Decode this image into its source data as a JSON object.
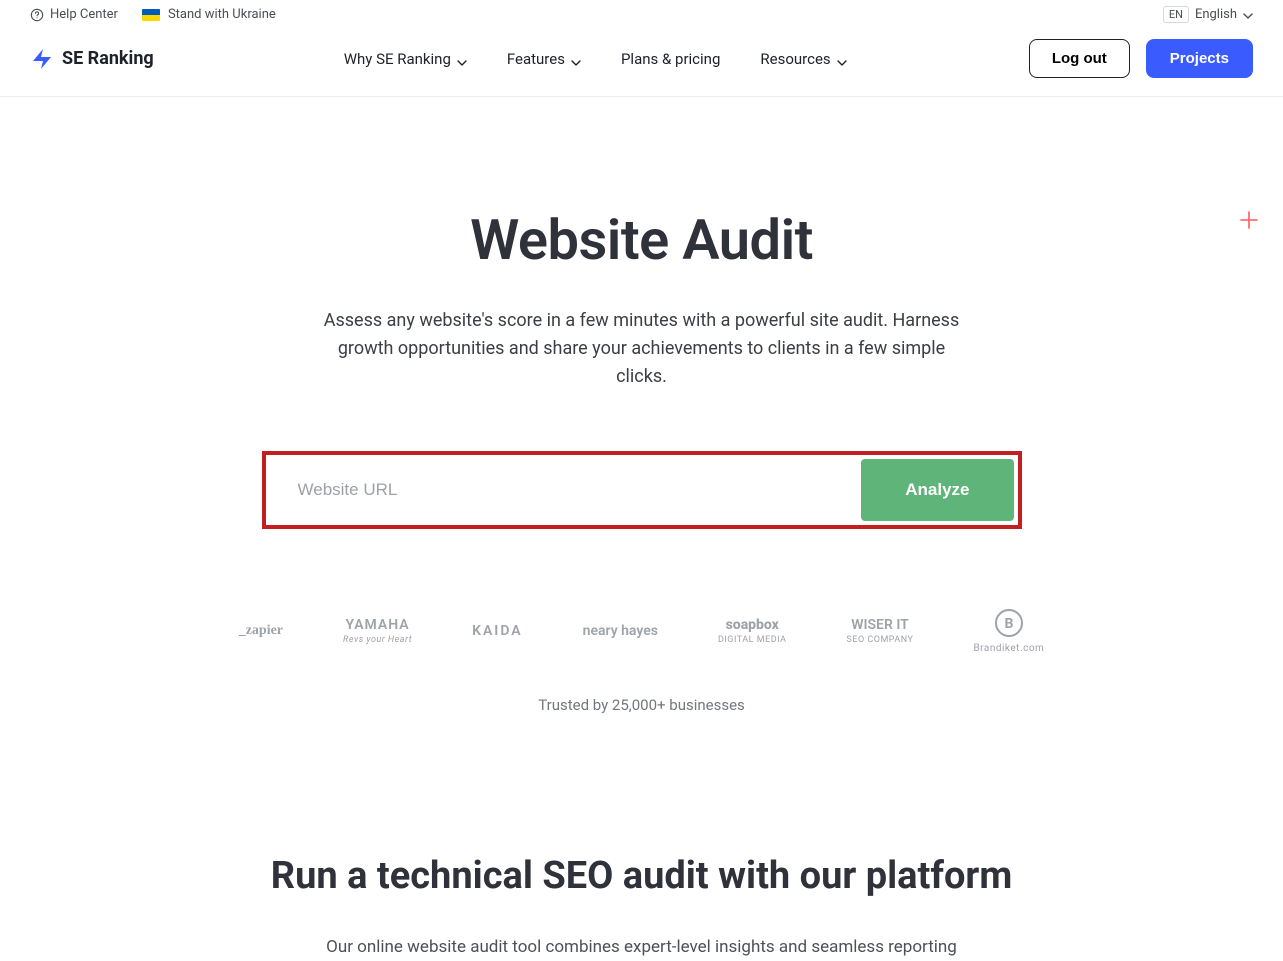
{
  "topbar": {
    "help_label": "Help Center",
    "ukraine_label": "Stand with Ukraine",
    "lang_code": "EN",
    "lang_name": "English"
  },
  "brand": {
    "name": "SE Ranking"
  },
  "nav": {
    "items": [
      {
        "label": "Why SE Ranking",
        "dropdown": true
      },
      {
        "label": "Features",
        "dropdown": true
      },
      {
        "label": "Plans & pricing",
        "dropdown": false
      },
      {
        "label": "Resources",
        "dropdown": true
      }
    ]
  },
  "actions": {
    "logout_label": "Log out",
    "projects_label": "Projects"
  },
  "hero": {
    "title": "Website Audit",
    "subtitle": "Assess any website's score in a few minutes with a powerful site audit. Harness growth opportunities and share your achievements to clients in a few simple clicks."
  },
  "url_form": {
    "placeholder": "Website URL",
    "value": "",
    "analyze_label": "Analyze"
  },
  "logos": {
    "items": [
      {
        "name": "_zapier",
        "sub": ""
      },
      {
        "name": "YAMAHA",
        "sub": "Revs your Heart"
      },
      {
        "name": "KAIDA",
        "sub": ""
      },
      {
        "name": "neary hayes",
        "sub": ""
      },
      {
        "name": "soapbox",
        "sub": "DIGITAL MEDIA"
      },
      {
        "name": "WISER IT",
        "sub": "SEO COMPANY"
      },
      {
        "name": "Brandiket.com",
        "sub": ""
      }
    ],
    "trusted_text": "Trusted by 25,000+ businesses"
  },
  "section2": {
    "title": "Run a technical SEO audit with our platform",
    "body": "Our online website audit tool combines expert-level insights and seamless reporting"
  },
  "colors": {
    "primary": "#3a5cff",
    "analyze": "#5fb579",
    "highlight_border": "#c22020"
  }
}
